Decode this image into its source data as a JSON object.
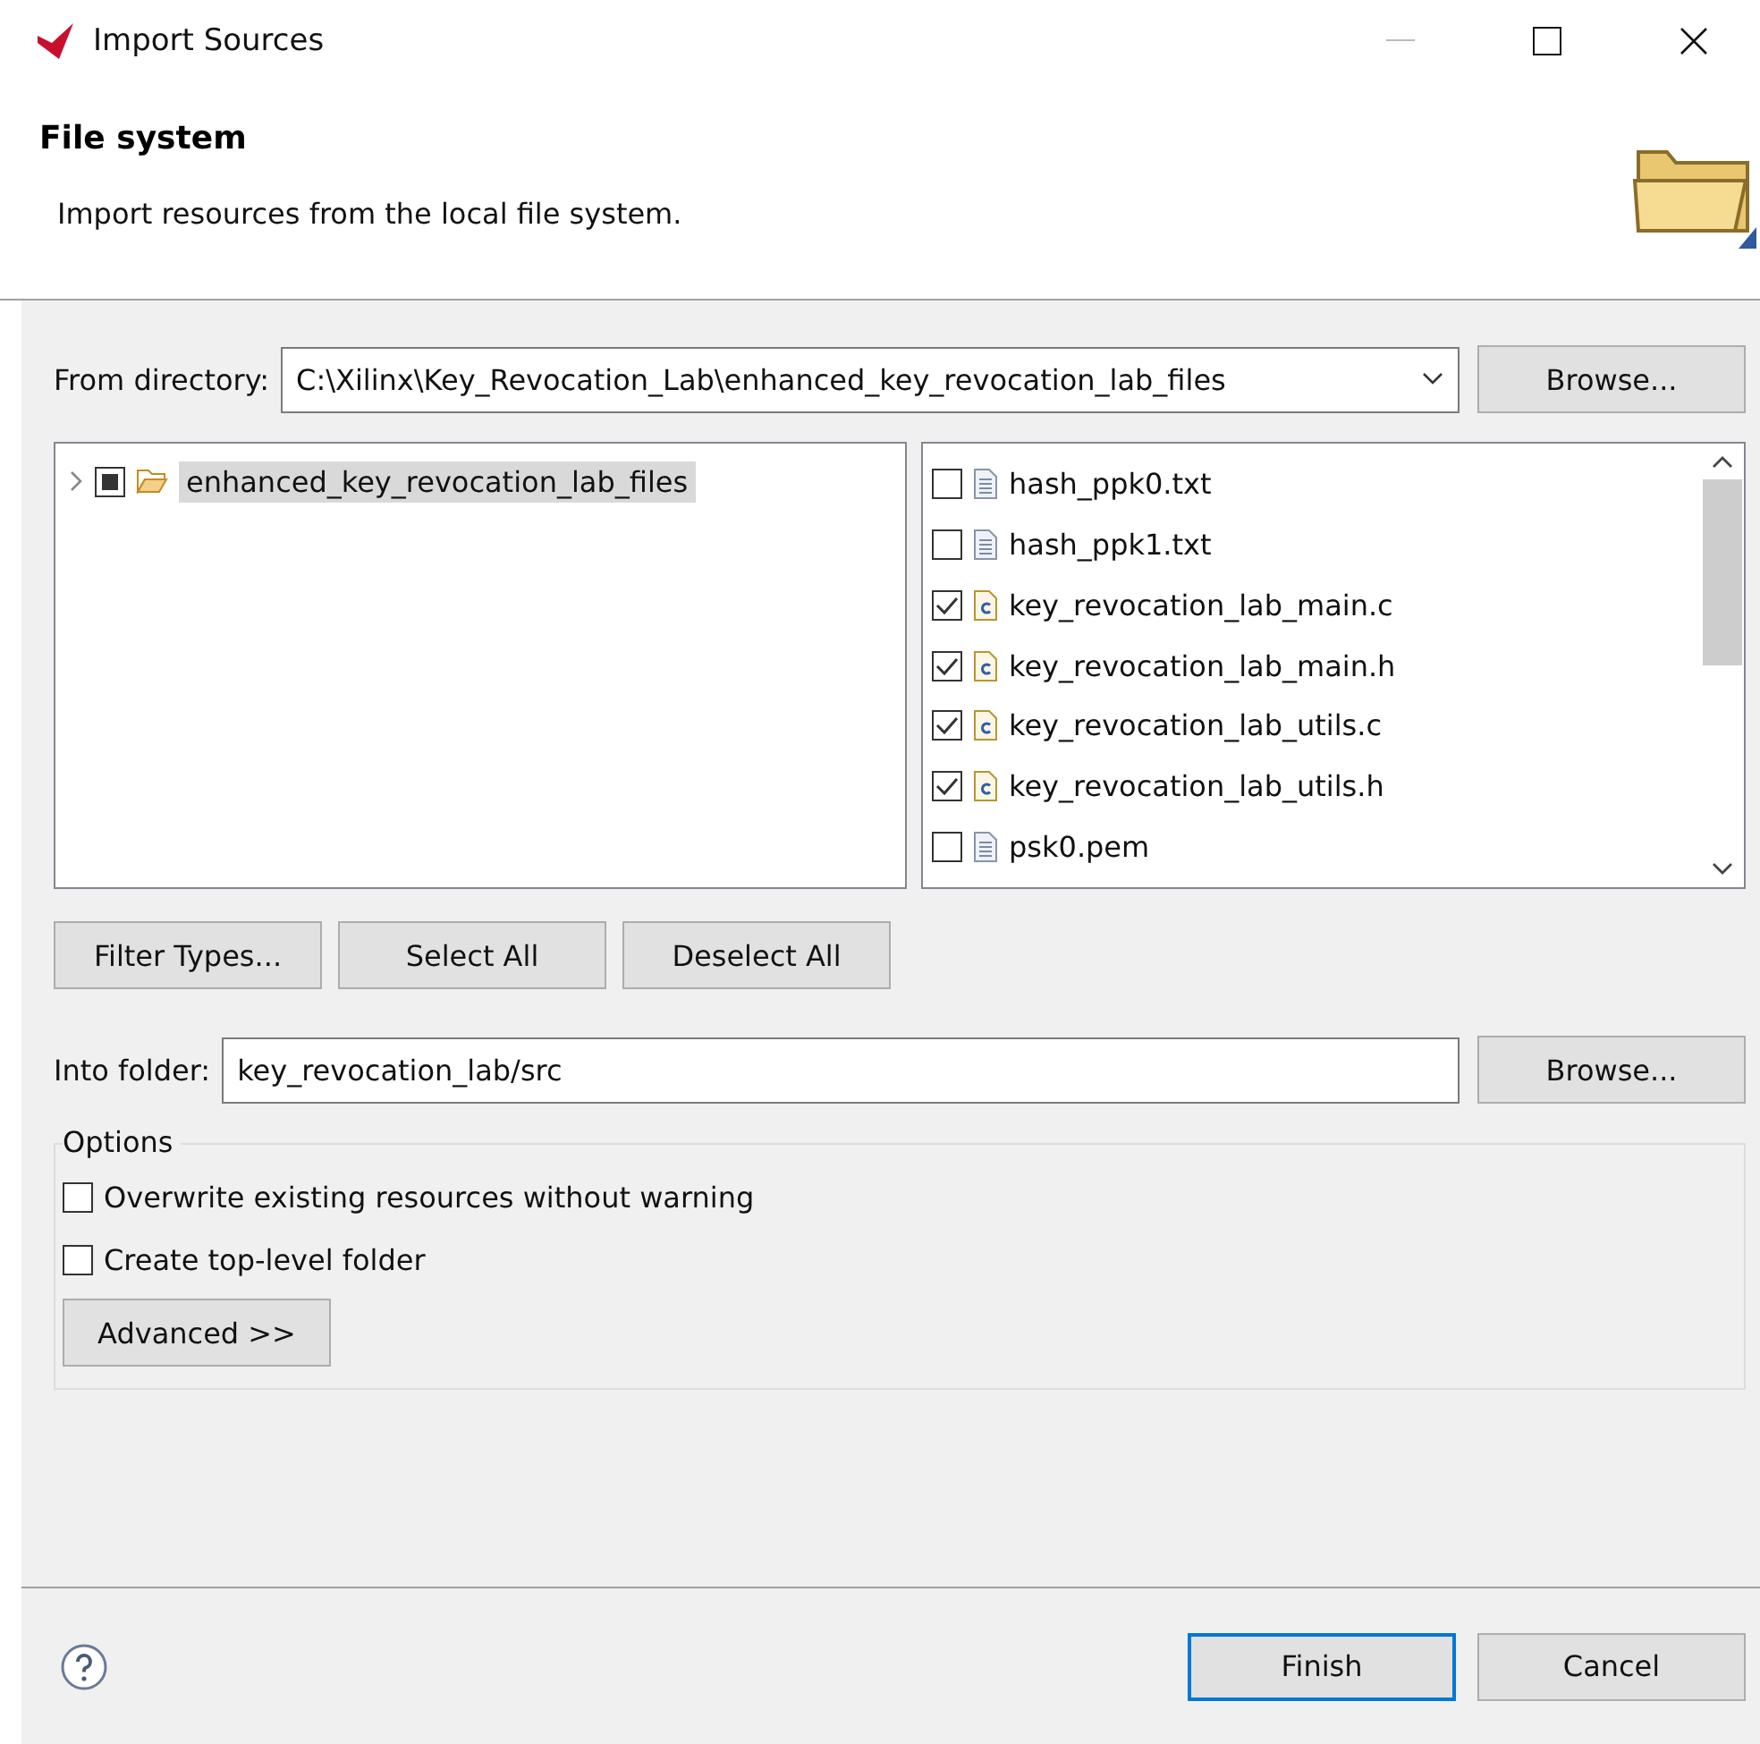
{
  "window": {
    "title": "Import Sources"
  },
  "header": {
    "title": "File system",
    "description": "Import resources from the local file system."
  },
  "from_directory": {
    "label": "From directory:",
    "value": "C:\\Xilinx\\Key_Revocation_Lab\\enhanced_key_revocation_lab_files",
    "button": "Browse..."
  },
  "folder_tree": [
    {
      "label": "enhanced_key_revocation_lab_files",
      "expanded": false,
      "partial": true,
      "selected": true
    }
  ],
  "files": [
    {
      "name": "hash_ppk0.txt",
      "kind": "text",
      "checked": false
    },
    {
      "name": "hash_ppk1.txt",
      "kind": "text",
      "checked": false
    },
    {
      "name": "key_revocation_lab_main.c",
      "kind": "source",
      "checked": true
    },
    {
      "name": "key_revocation_lab_main.h",
      "kind": "source",
      "checked": true
    },
    {
      "name": "key_revocation_lab_utils.c",
      "kind": "source",
      "checked": true
    },
    {
      "name": "key_revocation_lab_utils.h",
      "kind": "source",
      "checked": true
    },
    {
      "name": "psk0.pem",
      "kind": "text",
      "checked": false
    }
  ],
  "selection_buttons": [
    "Filter Types...",
    "Select All",
    "Deselect All"
  ],
  "into_folder": {
    "label": "Into folder:",
    "value": "key_revocation_lab/src",
    "button": "Browse..."
  },
  "options": {
    "title": "Options",
    "checkboxes": [
      {
        "label": "Overwrite existing resources without warning",
        "checked": false
      },
      {
        "label": "Create top-level folder",
        "checked": false
      }
    ],
    "advanced": "Advanced >>"
  },
  "footer": {
    "finish": "Finish",
    "cancel": "Cancel"
  }
}
